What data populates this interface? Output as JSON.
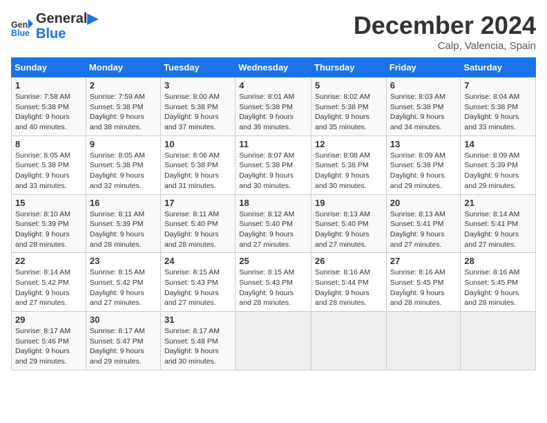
{
  "header": {
    "logo_line1": "General",
    "logo_line2": "Blue",
    "month": "December 2024",
    "location": "Calp, Valencia, Spain"
  },
  "weekdays": [
    "Sunday",
    "Monday",
    "Tuesday",
    "Wednesday",
    "Thursday",
    "Friday",
    "Saturday"
  ],
  "weeks": [
    [
      {
        "day": "1",
        "sunrise": "7:58 AM",
        "sunset": "5:38 PM",
        "daylight": "9 hours and 40 minutes."
      },
      {
        "day": "2",
        "sunrise": "7:59 AM",
        "sunset": "5:38 PM",
        "daylight": "9 hours and 38 minutes."
      },
      {
        "day": "3",
        "sunrise": "8:00 AM",
        "sunset": "5:38 PM",
        "daylight": "9 hours and 37 minutes."
      },
      {
        "day": "4",
        "sunrise": "8:01 AM",
        "sunset": "5:38 PM",
        "daylight": "9 hours and 36 minutes."
      },
      {
        "day": "5",
        "sunrise": "8:02 AM",
        "sunset": "5:38 PM",
        "daylight": "9 hours and 35 minutes."
      },
      {
        "day": "6",
        "sunrise": "8:03 AM",
        "sunset": "5:38 PM",
        "daylight": "9 hours and 34 minutes."
      },
      {
        "day": "7",
        "sunrise": "8:04 AM",
        "sunset": "5:38 PM",
        "daylight": "9 hours and 33 minutes."
      }
    ],
    [
      {
        "day": "8",
        "sunrise": "8:05 AM",
        "sunset": "5:38 PM",
        "daylight": "9 hours and 33 minutes."
      },
      {
        "day": "9",
        "sunrise": "8:05 AM",
        "sunset": "5:38 PM",
        "daylight": "9 hours and 32 minutes."
      },
      {
        "day": "10",
        "sunrise": "8:06 AM",
        "sunset": "5:38 PM",
        "daylight": "9 hours and 31 minutes."
      },
      {
        "day": "11",
        "sunrise": "8:07 AM",
        "sunset": "5:38 PM",
        "daylight": "9 hours and 30 minutes."
      },
      {
        "day": "12",
        "sunrise": "8:08 AM",
        "sunset": "5:38 PM",
        "daylight": "9 hours and 30 minutes."
      },
      {
        "day": "13",
        "sunrise": "8:09 AM",
        "sunset": "5:38 PM",
        "daylight": "9 hours and 29 minutes."
      },
      {
        "day": "14",
        "sunrise": "8:09 AM",
        "sunset": "5:39 PM",
        "daylight": "9 hours and 29 minutes."
      }
    ],
    [
      {
        "day": "15",
        "sunrise": "8:10 AM",
        "sunset": "5:39 PM",
        "daylight": "9 hours and 28 minutes."
      },
      {
        "day": "16",
        "sunrise": "8:11 AM",
        "sunset": "5:39 PM",
        "daylight": "9 hours and 28 minutes."
      },
      {
        "day": "17",
        "sunrise": "8:11 AM",
        "sunset": "5:40 PM",
        "daylight": "9 hours and 28 minutes."
      },
      {
        "day": "18",
        "sunrise": "8:12 AM",
        "sunset": "5:40 PM",
        "daylight": "9 hours and 27 minutes."
      },
      {
        "day": "19",
        "sunrise": "8:13 AM",
        "sunset": "5:40 PM",
        "daylight": "9 hours and 27 minutes."
      },
      {
        "day": "20",
        "sunrise": "8:13 AM",
        "sunset": "5:41 PM",
        "daylight": "9 hours and 27 minutes."
      },
      {
        "day": "21",
        "sunrise": "8:14 AM",
        "sunset": "5:41 PM",
        "daylight": "9 hours and 27 minutes."
      }
    ],
    [
      {
        "day": "22",
        "sunrise": "8:14 AM",
        "sunset": "5:42 PM",
        "daylight": "9 hours and 27 minutes."
      },
      {
        "day": "23",
        "sunrise": "8:15 AM",
        "sunset": "5:42 PM",
        "daylight": "9 hours and 27 minutes."
      },
      {
        "day": "24",
        "sunrise": "8:15 AM",
        "sunset": "5:43 PM",
        "daylight": "9 hours and 27 minutes."
      },
      {
        "day": "25",
        "sunrise": "8:15 AM",
        "sunset": "5:43 PM",
        "daylight": "9 hours and 28 minutes."
      },
      {
        "day": "26",
        "sunrise": "8:16 AM",
        "sunset": "5:44 PM",
        "daylight": "9 hours and 28 minutes."
      },
      {
        "day": "27",
        "sunrise": "8:16 AM",
        "sunset": "5:45 PM",
        "daylight": "9 hours and 28 minutes."
      },
      {
        "day": "28",
        "sunrise": "8:16 AM",
        "sunset": "5:45 PM",
        "daylight": "9 hours and 28 minutes."
      }
    ],
    [
      {
        "day": "29",
        "sunrise": "8:17 AM",
        "sunset": "5:46 PM",
        "daylight": "9 hours and 29 minutes."
      },
      {
        "day": "30",
        "sunrise": "8:17 AM",
        "sunset": "5:47 PM",
        "daylight": "9 hours and 29 minutes."
      },
      {
        "day": "31",
        "sunrise": "8:17 AM",
        "sunset": "5:48 PM",
        "daylight": "9 hours and 30 minutes."
      },
      null,
      null,
      null,
      null
    ]
  ]
}
